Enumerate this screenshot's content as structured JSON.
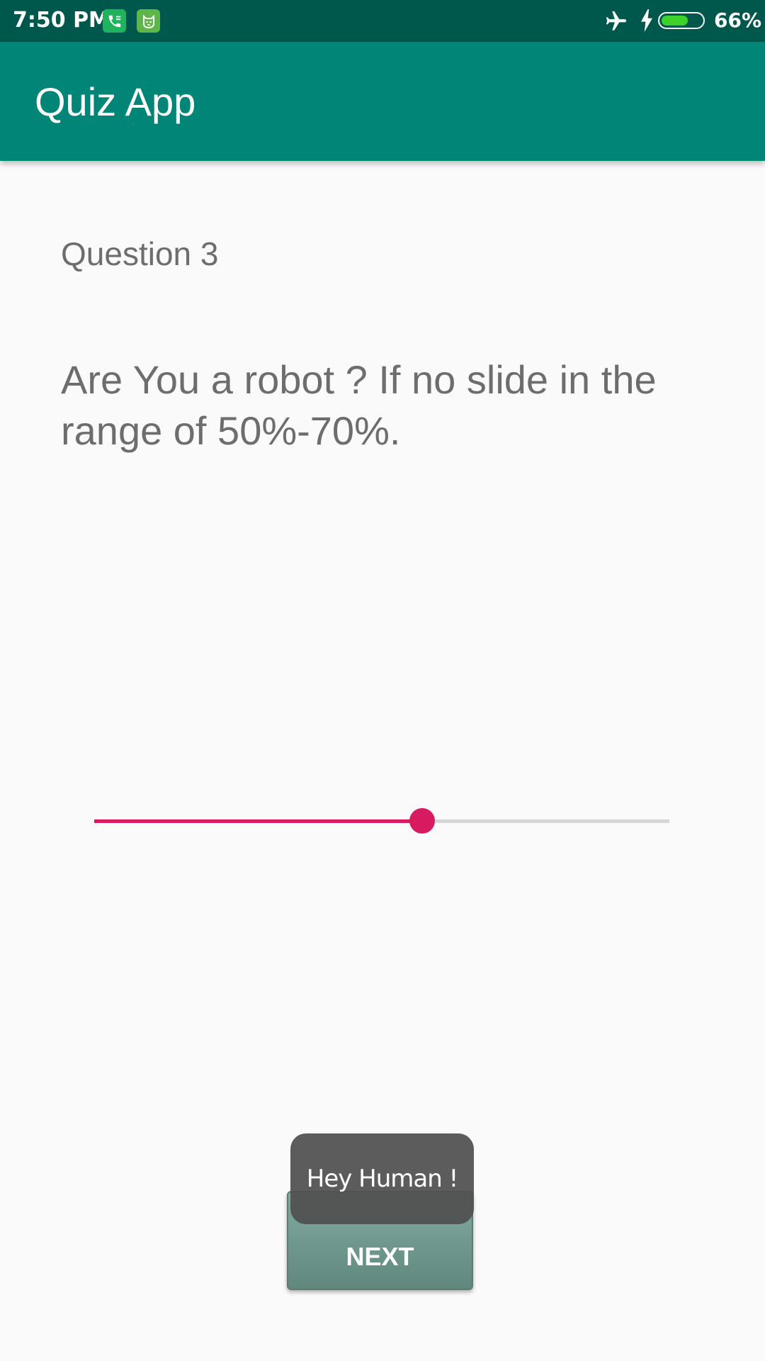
{
  "status_bar": {
    "time": "7:50 PM",
    "battery_percent": "66%",
    "battery_level": 0.66,
    "icons": [
      "phone-notification-icon",
      "cat-notification-icon",
      "airplane-mode-icon",
      "charging-icon",
      "battery-icon"
    ]
  },
  "app_bar": {
    "title": "Quiz App",
    "color": "#008577"
  },
  "quiz": {
    "question_number": "Question 3",
    "question_text": "Are You a robot ? If no slide in the range of 50%-70%.",
    "slider_value": 0.57,
    "slider_color": "#d81b60"
  },
  "toast": {
    "message": "Hey Human !"
  },
  "actions": {
    "next_label": "NEXT"
  }
}
